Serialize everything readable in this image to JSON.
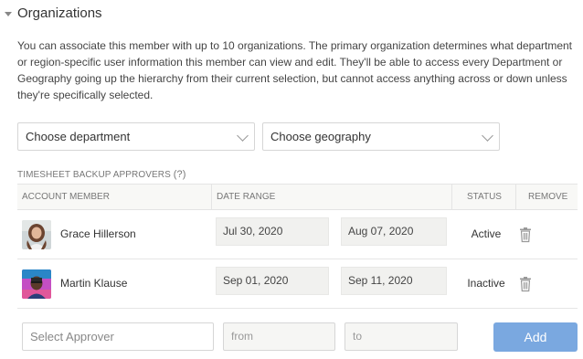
{
  "section": {
    "title": "Organizations"
  },
  "description": "You can associate this member with up to 10 organizations. The primary organization determines what department or region-specific user information this member can view and edit. They'll be able to access every Department or Geography going up the hierarchy from their current selection, but cannot access anything across or down unless they're specifically selected.",
  "selects": {
    "department": "Choose department",
    "geography": "Choose geography"
  },
  "approvers": {
    "label": "TIMESHEET BACKUP APPROVERS",
    "help": "(?)",
    "columns": [
      "ACCOUNT MEMBER",
      "DATE RANGE",
      "STATUS",
      "REMOVE"
    ],
    "rows": [
      {
        "name": "Grace Hillerson",
        "from": "Jul 30, 2020",
        "to": "Aug 07, 2020",
        "status": "Active"
      },
      {
        "name": "Martin Klause",
        "from": "Sep 01, 2020",
        "to": "Sep 11, 2020",
        "status": "Inactive"
      }
    ],
    "new_row": {
      "approver_placeholder": "Select Approver",
      "from_placeholder": "from",
      "to_placeholder": "to",
      "add_label": "Add"
    }
  },
  "colors": {
    "accent": "#7aa8e0",
    "header_bg": "#f8f8f6",
    "date_bg": "#f1f1ef"
  },
  "icons": {
    "collapse": "caret-down-icon",
    "dropdown": "chevron-down-icon",
    "remove": "trash-icon"
  }
}
